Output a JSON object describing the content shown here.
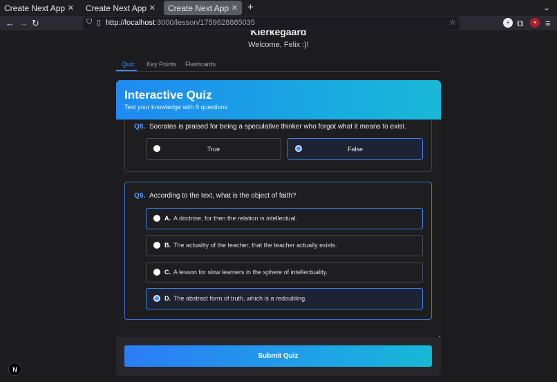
{
  "browser": {
    "tabs": [
      {
        "title": "Create Next App",
        "active": false
      },
      {
        "title": "Create Next App",
        "active": false
      },
      {
        "title": "Create Next App",
        "active": true
      }
    ],
    "url_host": "http://localhost",
    "url_path": ":3000/lesson/1759628885035"
  },
  "page": {
    "lesson_title": "Kierkegaard",
    "welcome": "Welcome, Felix :)!",
    "tabs": [
      "Quiz",
      "Key Points",
      "Flashcards"
    ],
    "active_tab": "Quiz"
  },
  "quiz": {
    "title": "Interactive Quiz",
    "subtitle": "Test your knowledge with 9 questions",
    "q8": {
      "number": "Q8.",
      "text": "Socrates is praised for being a speculative thinker who forgot what it means to exist.",
      "options": [
        {
          "label": "True",
          "selected": false
        },
        {
          "label": "False",
          "selected": true
        }
      ]
    },
    "q9": {
      "number": "Q9.",
      "text": "According to the text, what is the object of faith?",
      "options": [
        {
          "letter": "A.",
          "text": "A doctrine, for then the relation is intellectual.",
          "selected": false
        },
        {
          "letter": "B.",
          "text": "The actuality of the teacher, that the teacher actually exists.",
          "selected": false
        },
        {
          "letter": "C.",
          "text": "A lesson for slow learners in the sphere of intellectuality.",
          "selected": false
        },
        {
          "letter": "D.",
          "text": "The abstract form of truth, which is a redoubling.",
          "selected": true
        }
      ]
    },
    "submit_label": "Submit Quiz"
  },
  "colors": {
    "accent": "#3d8bfd",
    "header_gradient_start": "#1f8af2",
    "header_gradient_end": "#1ab9d8"
  },
  "icons": [
    "back-icon",
    "forward-icon",
    "reload-icon",
    "shield-icon",
    "page-icon",
    "bookmark-star-icon",
    "extension-icon",
    "puzzle-icon",
    "menu-icon",
    "nextjs-logo-icon"
  ]
}
